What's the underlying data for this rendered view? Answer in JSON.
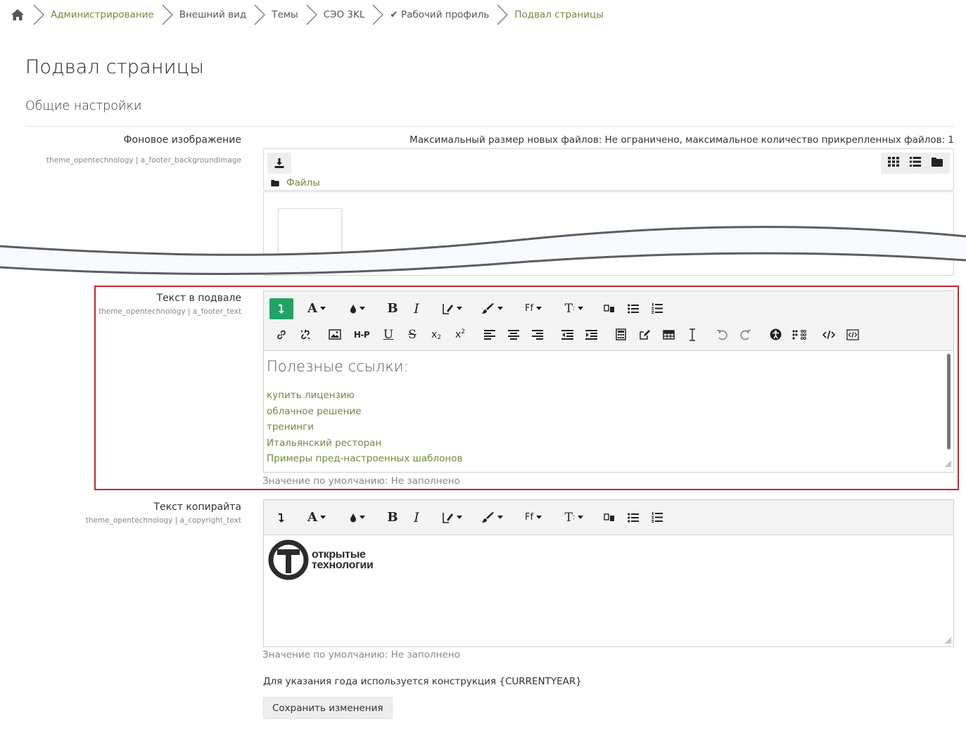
{
  "breadcrumb": {
    "items": [
      {
        "label": "Администрирование"
      },
      {
        "label": "Внешний вид"
      },
      {
        "label": "Темы"
      },
      {
        "label": "СЭО 3KL"
      },
      {
        "label": "✔ Рабочий профиль"
      },
      {
        "label": "Подвал страницы"
      }
    ]
  },
  "page_title": "Подвал страницы",
  "section_title": "Общие настройки",
  "bg_image": {
    "label": "Фоновое изображение",
    "key": "theme_opentechnology | a_footer_backgroundimage",
    "limits": "Максимальный размер новых файлов: Не ограничено, максимальное количество прикрепленных файлов: 1",
    "path_label": "Файлы"
  },
  "footer_text": {
    "label": "Текст в подвале",
    "key": "theme_opentechnology | a_footer_text",
    "heading": "Полезные ссылки:",
    "links": [
      "купить лицензию",
      "облачное решение",
      "тренинги",
      "Итальянский ресторан",
      "Примеры пред-настроенных шаблонов"
    ],
    "default_note": "Значение по умолчанию: Не заполнено"
  },
  "copyright": {
    "label": "Текст копирайта",
    "key": "theme_opentechnology | a_copyright_text",
    "logo_line1": "открытые",
    "logo_line2": "технологии",
    "default_note": "Значение по умолчанию: Не заполнено",
    "year_note": "Для указания года используется конструкция {CURRENTYEAR}"
  },
  "save_label": "Сохранить изменения",
  "colors": {
    "link": "#6f8a3c",
    "active_toolbar": "#20a464",
    "highlight_border": "#d0212a"
  },
  "toolbar_row1_icons": [
    "collapse-icon",
    "font-color-icon",
    "background-color-icon",
    "bold-icon",
    "italic-icon",
    "styles-icon",
    "brush-icon",
    "font-family-icon",
    "font-size-icon",
    "language-icon",
    "bullet-list-icon",
    "numbered-list-icon"
  ],
  "toolbar_row2_icons": [
    "link-icon",
    "unlink-icon",
    "image-icon",
    "h5p-icon",
    "underline-icon",
    "strikethrough-icon",
    "subscript-icon",
    "superscript-icon",
    "align-left-icon",
    "align-center-icon",
    "align-right-icon",
    "outdent-icon",
    "indent-icon",
    "equation-icon",
    "edit-icon",
    "table-icon",
    "clear-format-icon",
    "undo-icon",
    "redo-icon",
    "accessibility-icon",
    "screenreader-icon",
    "html-icon",
    "html-edit-icon"
  ]
}
